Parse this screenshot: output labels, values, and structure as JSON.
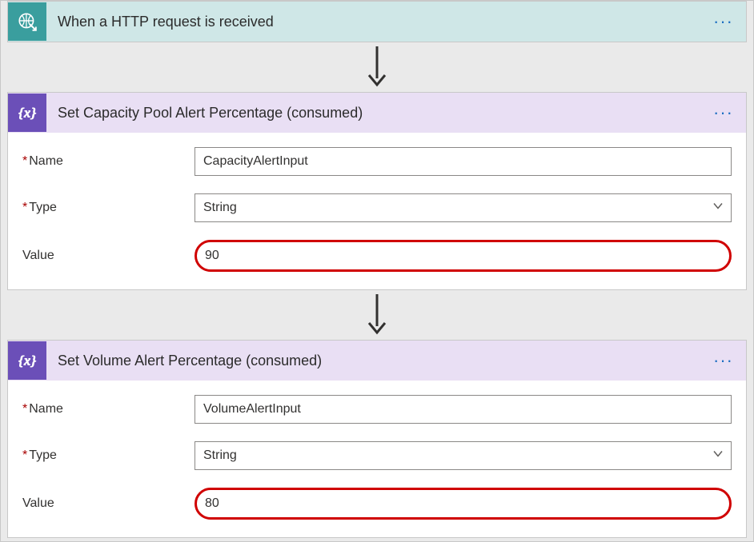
{
  "trigger": {
    "title": "When a HTTP request is received"
  },
  "step1": {
    "title": "Set Capacity Pool Alert Percentage (consumed)",
    "name_label": "Name",
    "name_value": "CapacityAlertInput",
    "type_label": "Type",
    "type_value": "String",
    "value_label": "Value",
    "value_value": "90"
  },
  "step2": {
    "title": "Set Volume Alert Percentage (consumed)",
    "name_label": "Name",
    "name_value": "VolumeAlertInput",
    "type_label": "Type",
    "type_value": "String",
    "value_label": "Value",
    "value_value": "80"
  }
}
